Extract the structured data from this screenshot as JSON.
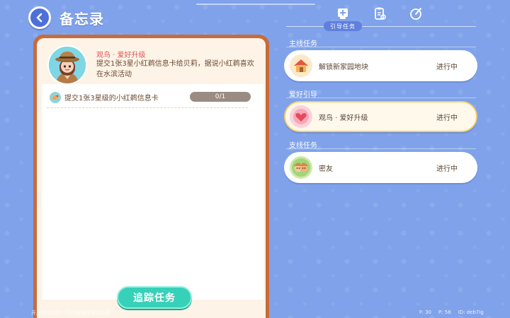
{
  "header": {
    "title": "备忘录"
  },
  "top_tabs": {
    "items": [
      {
        "icon": "quest-board-icon"
      },
      {
        "icon": "clipboard-icon"
      },
      {
        "icon": "pencil-badge-icon"
      }
    ],
    "active_label": "引导任务"
  },
  "detail": {
    "task_name": "观鸟 · 爱好升级",
    "description": "提交1张3星小红鹈信息卡给贝莉，据说小红鹈喜欢在水滨活动",
    "objective": {
      "text": "提交1张3星级的小红鹈信息卡",
      "progress": "0/1"
    },
    "track_button": "追踪任务"
  },
  "sections": [
    {
      "label": "主线任务",
      "quests": [
        {
          "label": "解锁新家园地块",
          "status": "进行中",
          "icon": "house-icon"
        }
      ]
    },
    {
      "label": "爱好引导",
      "quests": [
        {
          "label": "观鸟 · 爱好升级",
          "status": "进行中",
          "icon": "heart-icon",
          "selected": true
        }
      ]
    },
    {
      "label": "支线任务",
      "quests": [
        {
          "label": "密友",
          "status": "进行中",
          "icon": "friends-icon"
        }
      ]
    }
  ],
  "footer": {
    "left": "开发测试版本，不代表最终游戏品质",
    "fps": "F: 30",
    "ping": "P: 58",
    "id": "ID: deb7ig"
  },
  "colors": {
    "background": "#7fa2ea",
    "card_border": "#c76b3c",
    "accent_teal": "#36d1b8",
    "task_name_red": "#e0575a",
    "selected_border": "#f2cf6c"
  }
}
